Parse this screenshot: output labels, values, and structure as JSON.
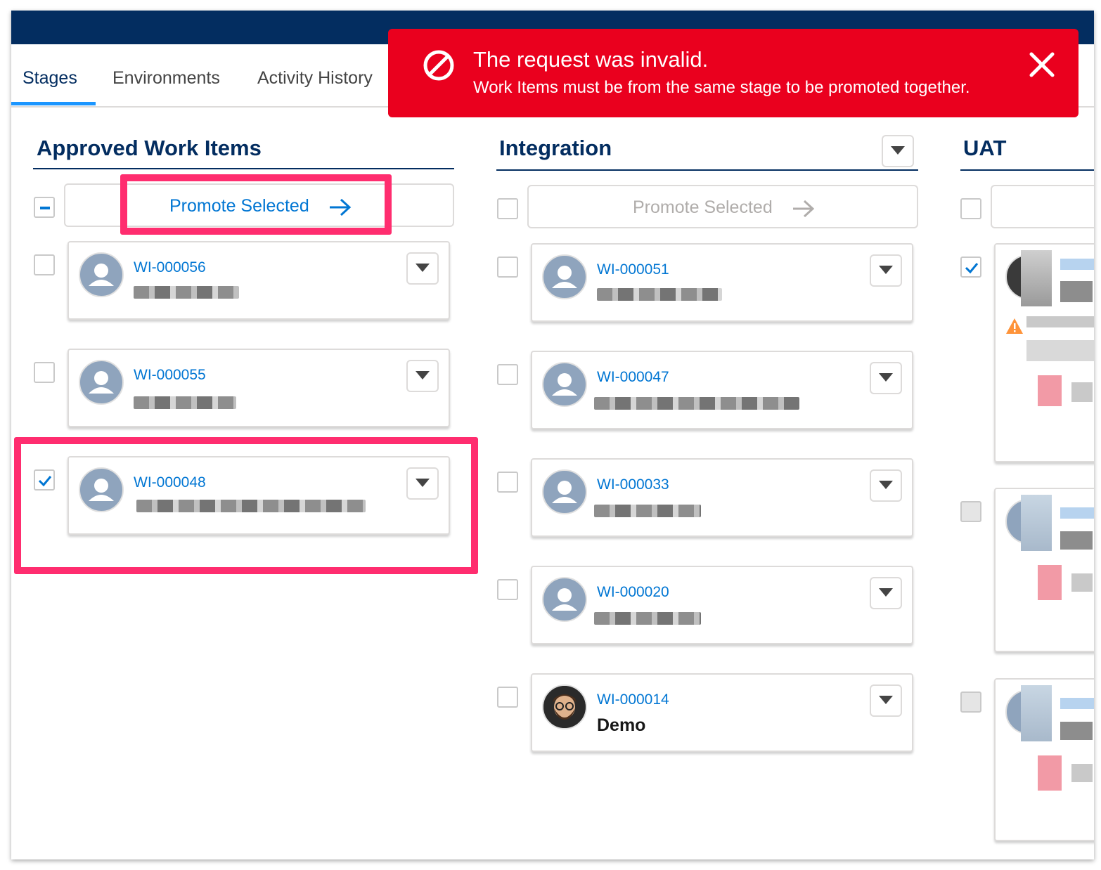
{
  "tabs": [
    {
      "label": "Stages",
      "active": true
    },
    {
      "label": "Environments",
      "active": false
    },
    {
      "label": "Activity History",
      "active": false
    }
  ],
  "toast": {
    "title": "The request was invalid.",
    "message": "Work Items must be from the same stage to be promoted together.",
    "icon": "ban-icon",
    "close_icon": "close-icon",
    "color": "#ea001e"
  },
  "columns": {
    "approved": {
      "title": "Approved Work Items",
      "promote_label": "Promote Selected",
      "select_all_state": "indeterminate",
      "items": [
        {
          "id": "WI-000056",
          "checked": false
        },
        {
          "id": "WI-000055",
          "checked": false
        },
        {
          "id": "WI-000048",
          "checked": true
        }
      ]
    },
    "integration": {
      "title": "Integration",
      "promote_label": "Promote Selected",
      "promote_disabled": true,
      "items": [
        {
          "id": "WI-000051",
          "checked": false
        },
        {
          "id": "WI-000047",
          "checked": false
        },
        {
          "id": "WI-000033",
          "checked": false
        },
        {
          "id": "WI-000020",
          "checked": false
        },
        {
          "id": "WI-000014",
          "name": "Demo",
          "checked": false
        }
      ]
    },
    "uat": {
      "title": "UAT"
    }
  },
  "colors": {
    "nav": "#032d60",
    "accent": "#0176d3",
    "highlight": "#ff2d6f"
  }
}
